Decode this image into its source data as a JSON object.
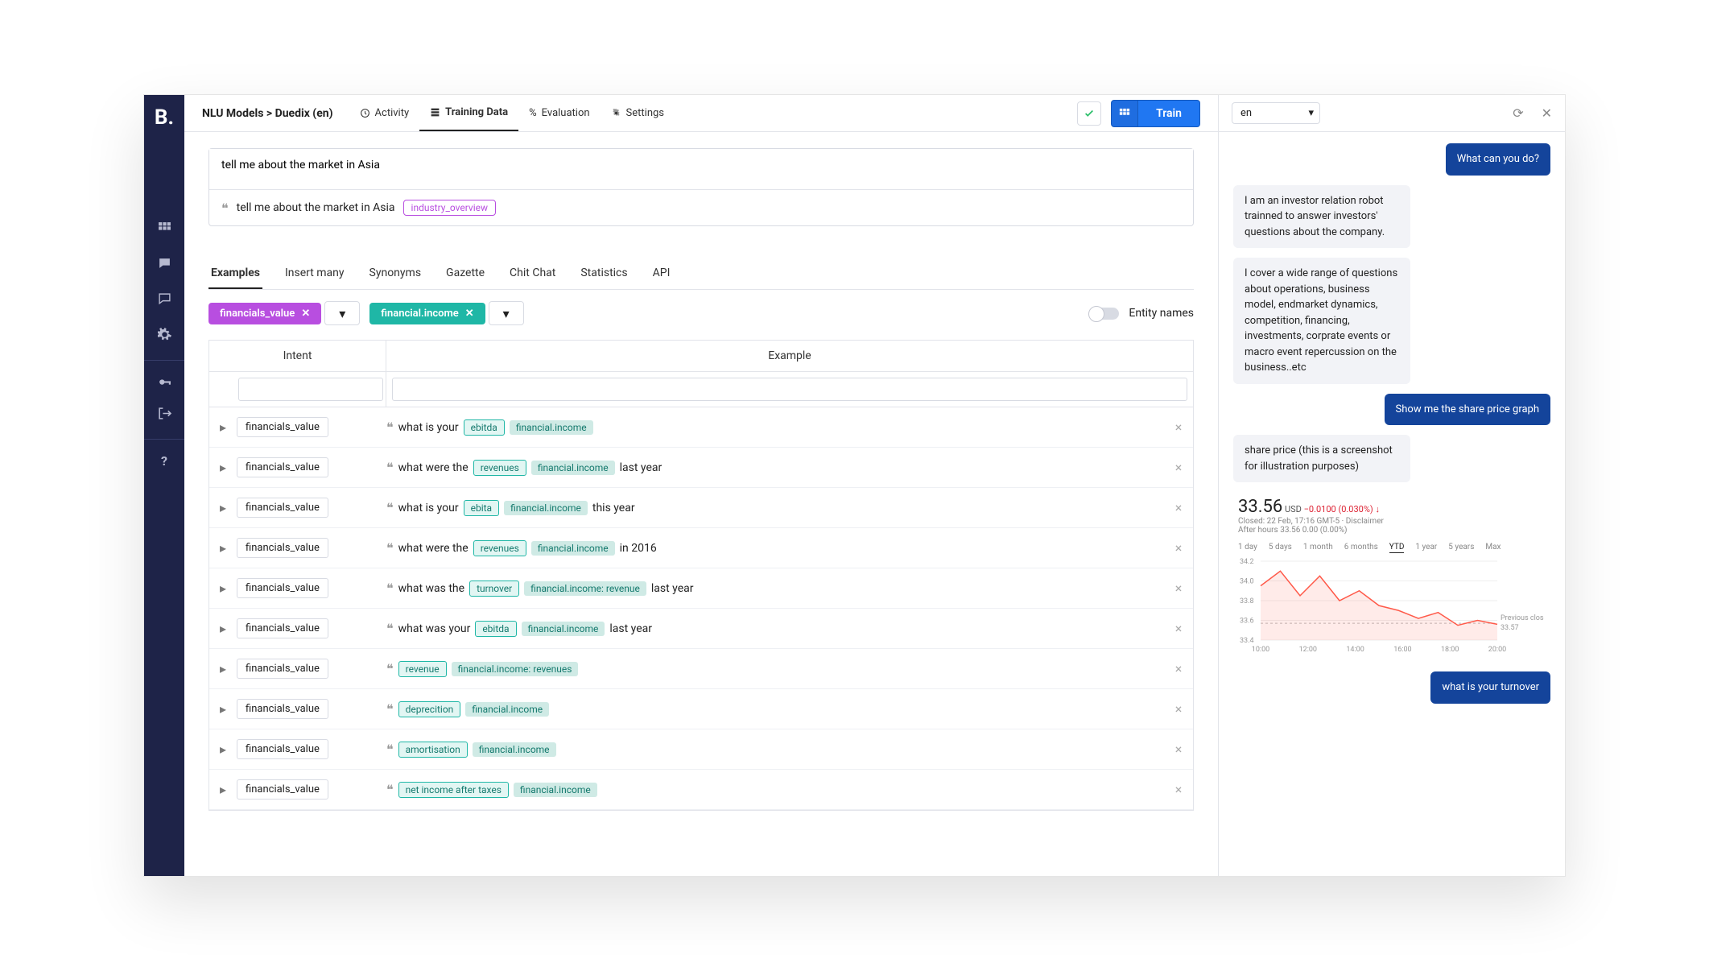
{
  "logo": "B.",
  "breadcrumb": "NLU Models > Duedix (en)",
  "topnav": [
    {
      "label": "Activity"
    },
    {
      "label": "Training Data"
    },
    {
      "label": "Evaluation"
    },
    {
      "label": "Settings"
    }
  ],
  "train_label": "Train",
  "example_text": "tell me about the market in Asia",
  "parsed_text": "tell me about the market in Asia",
  "parsed_intent": "industry_overview",
  "subtabs": [
    "Examples",
    "Insert many",
    "Synonyms",
    "Gazette",
    "Chit Chat",
    "Statistics",
    "API"
  ],
  "filters": {
    "f1": "financials_value",
    "f2": "financial.income"
  },
  "toggle_label": "Entity names",
  "table": {
    "head_intent": "Intent",
    "head_example": "Example"
  },
  "rows": [
    {
      "intent": "financials_value",
      "pre": "what is your ",
      "ent": "ebitda",
      "lab": "financial.income",
      "post": ""
    },
    {
      "intent": "financials_value",
      "pre": "what were the ",
      "ent": "revenues",
      "lab": "financial.income",
      "post": " last year"
    },
    {
      "intent": "financials_value",
      "pre": "what is your ",
      "ent": "ebita",
      "lab": "financial.income",
      "post": " this year"
    },
    {
      "intent": "financials_value",
      "pre": "what were the ",
      "ent": "revenues",
      "lab": "financial.income",
      "post": " in 2016"
    },
    {
      "intent": "financials_value",
      "pre": "what was the ",
      "ent": "turnover",
      "lab": "financial.income: revenue",
      "post": " last year"
    },
    {
      "intent": "financials_value",
      "pre": "what was your ",
      "ent": "ebitda",
      "lab": "financial.income",
      "post": " last year"
    },
    {
      "intent": "financials_value",
      "pre": "",
      "ent": "revenue",
      "lab": "financial.income: revenues",
      "post": ""
    },
    {
      "intent": "financials_value",
      "pre": "",
      "ent": "deprecition",
      "lab": "financial.income",
      "post": ""
    },
    {
      "intent": "financials_value",
      "pre": "",
      "ent": "amortisation",
      "lab": "financial.income",
      "post": ""
    },
    {
      "intent": "financials_value",
      "pre": "",
      "ent": "net income after taxes",
      "lab": "financial.income",
      "post": ""
    }
  ],
  "chat": {
    "lang": "en",
    "messages": [
      {
        "role": "user",
        "text": "What can you do?"
      },
      {
        "role": "bot",
        "text": "I am an investor relation robot trainned to answer investors' questions about the company."
      },
      {
        "role": "bot",
        "text": "I cover a wide range of questions about operations, business model, endmarket dynamics, competition, financing, investments, corprate events or macro event repercussion on the business..etc"
      },
      {
        "role": "user",
        "text": "Show me the share price graph"
      },
      {
        "role": "bot",
        "text": "share price (this is a screenshot for illustration purposes)"
      }
    ],
    "tail_user": "what is your turnover"
  },
  "stock": {
    "price": "33.56",
    "currency": "USD",
    "change": "−0.0100 (0.030%)",
    "arrow": "↓",
    "line1": "Closed: 22 Feb, 17:16 GMT-5 · Disclaimer",
    "line2": "After hours 33.56 0.00 (0.00%)",
    "ranges": [
      "1 day",
      "5 days",
      "1 month",
      "6 months",
      "YTD",
      "1 year",
      "5 years",
      "Max"
    ],
    "prev_label": "Previous close",
    "prev_value": "33.57",
    "yticks": [
      "34.2",
      "34.0",
      "33.8",
      "33.6",
      "33.4"
    ],
    "xticks": [
      "10:00",
      "12:00",
      "14:00",
      "16:00",
      "18:00",
      "20:00"
    ]
  },
  "chart_data": {
    "type": "line",
    "title": "",
    "xlabel": "",
    "ylabel": "",
    "ylim": [
      33.4,
      34.2
    ],
    "x": [
      "10:00",
      "10:30",
      "11:00",
      "11:30",
      "12:00",
      "12:30",
      "13:00",
      "13:30",
      "14:00",
      "14:30",
      "15:00",
      "15:30",
      "16:00"
    ],
    "values": [
      33.95,
      34.1,
      33.85,
      34.05,
      33.8,
      33.9,
      33.75,
      33.7,
      33.62,
      33.68,
      33.55,
      33.6,
      33.56
    ],
    "annotations": {
      "previous_close": 33.57
    }
  }
}
